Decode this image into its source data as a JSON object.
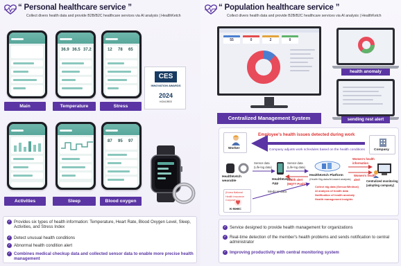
{
  "left": {
    "title": "“ Personal healthcare service ”",
    "subtitle": "Collect divers health data and provide B2B/B2C healthcare services via AI analysis | HealthKetch",
    "phones_top": [
      {
        "label": "Main",
        "v1": "",
        "v2": "",
        "v3": ""
      },
      {
        "label": "Temperature",
        "v1": "36.9",
        "v2": "36.5",
        "v3": "37.2"
      },
      {
        "label": "Stress",
        "v1": "12",
        "v2": "78",
        "v3": "65"
      }
    ],
    "phones_bottom": [
      {
        "label": "Activities",
        "v1": "",
        "v2": "",
        "v3": ""
      },
      {
        "label": "Sleep",
        "v1": "",
        "v2": "",
        "v3": ""
      },
      {
        "label": "Blood oxygen",
        "v1": "87",
        "v2": "95",
        "v3": "97"
      }
    ],
    "award": {
      "logo": "CES",
      "line1": "INNOVATION AWARDS",
      "year": "2024",
      "line2": "HONOREE"
    },
    "bullets": [
      "Provides six types of health information: Temperature, Heart Rate, Blood Oxygen Level, Sleep, Activities, and Stress Index",
      "Detect unusual health conditions",
      "Abnormal health condition alert",
      "Combines medical checkup data and collected sensor data to enable more precise health management"
    ]
  },
  "right": {
    "title": "“ Population healthcare service ”",
    "subtitle": "Collect divers health data and provide B2B/B2C healthcare services via AI analysis | HealthKetch",
    "monitor_kpis": [
      "55",
      "0",
      "2",
      "0"
    ],
    "cms_label": "Centralized Management System",
    "anomaly_label": "health anomaly",
    "rest_label": "sending rest alert",
    "flow": {
      "headline": "Employee's health issues detected during work",
      "sub": "Company adjusts work schedules based on the health conditions",
      "worker": "Worker",
      "company": "Company",
      "wearable": "HealthKetch wearable",
      "sensor_data": "Sensor data (Life-log data)",
      "app": "HealthKetch App",
      "sensor_data2": "Sensor data (Life-log data)",
      "alert": "health alert (MQTT Push)",
      "platform": "HealthKetch Platform",
      "platform_sub": "(Health Big-data/AI-based analysis)",
      "features": [
        "Collect big data (Sensor/Medical)",
        "AI analysis of health data",
        "Notification of health anomaly",
        "Health management insights"
      ],
      "womens": "Women's health information",
      "womens2": "Women's health alert",
      "central": "Centralized monitoring (adopting company)",
      "knhic": "K-NHIC",
      "knhic_sub": "(Korea National Health Insurance Corporation)",
      "medical": "Medical data"
    },
    "bullets": [
      "Service designed to provide health management for organizations",
      "Real-time detection of the member's health problems and sends notification to central administrator",
      "Improving productivity with central monitoring system"
    ]
  },
  "colors": {
    "accent": "#5a35a3",
    "alert_red": "#d33a3a",
    "phone_teal": "#58a79b"
  },
  "icons": {
    "header": "heartbeat-icon",
    "check": "check-icon"
  }
}
